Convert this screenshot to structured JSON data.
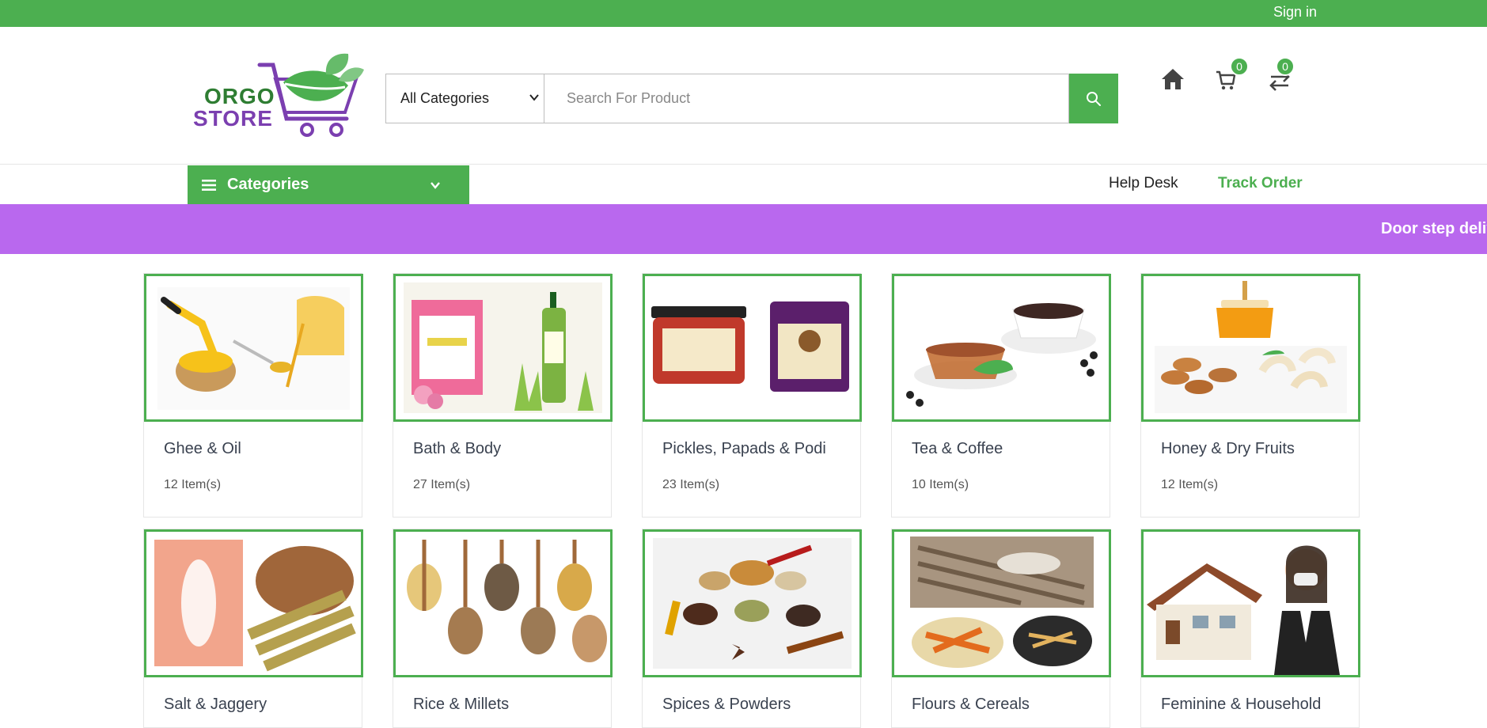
{
  "topbar": {
    "signin_label": "Sign in"
  },
  "header": {
    "logo_line1": "ORGO",
    "logo_line2": "STORE",
    "category_select": "All Categories",
    "search_placeholder": "Search For Product",
    "cart_count": "0",
    "compare_count": "0"
  },
  "nav": {
    "categories_label": "Categories",
    "help_desk": "Help Desk",
    "track_order": "Track Order"
  },
  "banner": {
    "text": "Door step delive"
  },
  "categories": [
    {
      "name": "Ghee & Oil",
      "count": "12 Item(s)"
    },
    {
      "name": "Bath & Body",
      "count": "27 Item(s)"
    },
    {
      "name": "Pickles, Papads & Podi",
      "count": "23 Item(s)"
    },
    {
      "name": "Tea & Coffee",
      "count": "10 Item(s)"
    },
    {
      "name": "Honey & Dry Fruits",
      "count": "12 Item(s)"
    },
    {
      "name": "Salt & Jaggery"
    },
    {
      "name": "Rice & Millets"
    },
    {
      "name": "Spices & Powders"
    },
    {
      "name": "Flours & Cereals"
    },
    {
      "name": "Feminine & Household"
    }
  ],
  "colors": {
    "brand_green": "#4caf50",
    "banner_purple": "#b968ee",
    "logo_purple": "#7b3fb0"
  }
}
